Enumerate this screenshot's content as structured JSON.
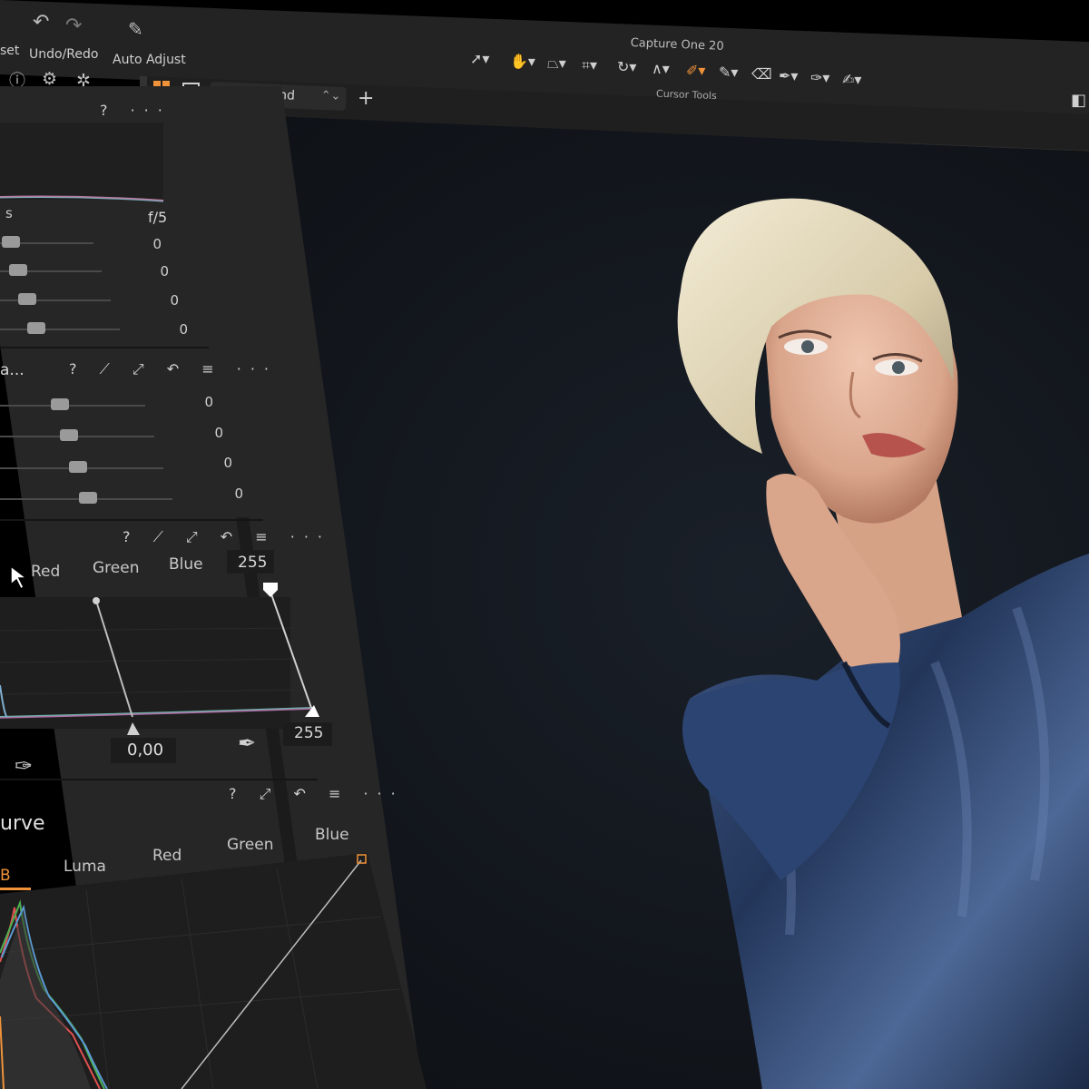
{
  "toolbar": {
    "reset_label": "set",
    "undo_redo_label": "Undo/Redo",
    "auto_adjust_label": "Auto Adjust",
    "app_title": "Capture One 20",
    "cursor_tools_label": "Cursor Tools"
  },
  "viewer": {
    "layer_select_value": "Background",
    "layer_select_chevron": "⌃⌄",
    "add_layer_glyph": "+"
  },
  "exposure_panel": {
    "header_glyphs": "? ···",
    "shutter_fragment": "s",
    "aperture": "f/5",
    "values": [
      "0",
      "0",
      "0",
      "0"
    ]
  },
  "hdr_panel": {
    "title_fragment": "a...",
    "header_glyphs": "? ⟋ ⤢ ↶ ≡ ···",
    "values": [
      "0",
      "0",
      "0",
      "0"
    ]
  },
  "levels_panel": {
    "header_glyphs": "? ⟋ ⤢ ↶ ≡ ···",
    "tabs": [
      "Red",
      "Green",
      "Blue"
    ],
    "top_value": "255",
    "midpoint_value": "0,00",
    "bottom_right_value": "255"
  },
  "curve_panel": {
    "header_glyphs": "? ⤢ ↶ ≡ ···",
    "title_fragment": "urve",
    "tabs": [
      "B",
      "Luma",
      "Red",
      "Green",
      "Blue"
    ]
  },
  "colors": {
    "accent": "#f0923a",
    "panel_bg": "#262626",
    "viewer_bg": "#12161c"
  }
}
